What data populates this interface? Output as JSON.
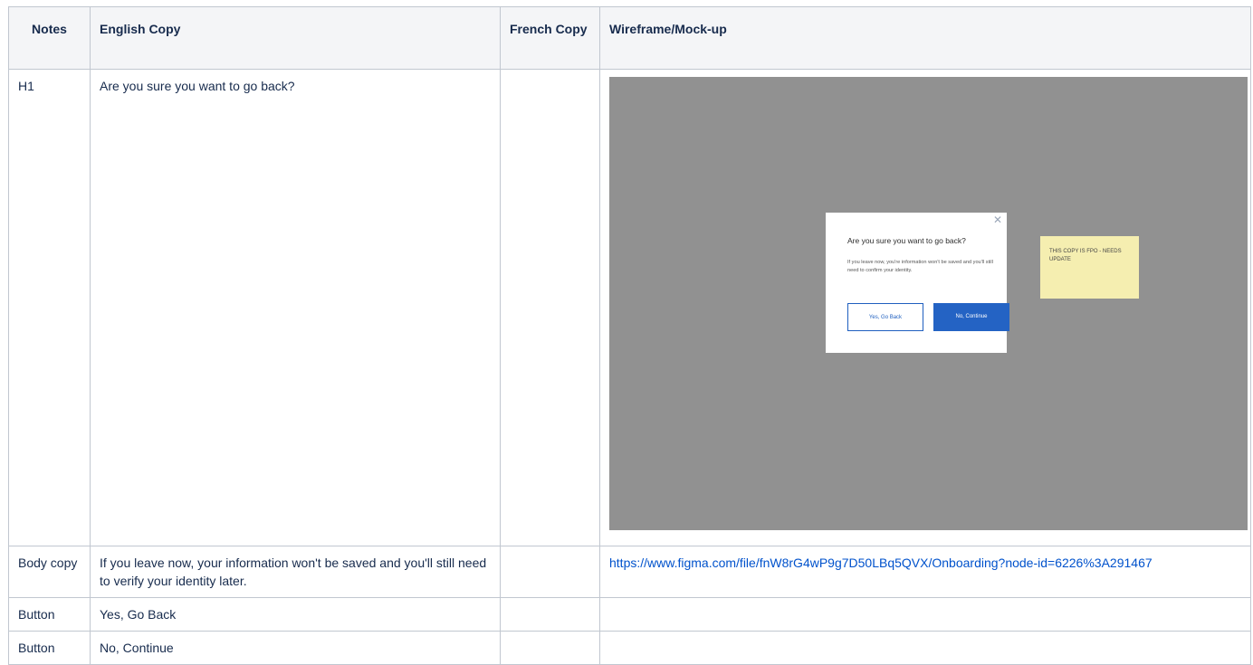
{
  "table": {
    "headers": {
      "notes": "Notes",
      "english": "English Copy",
      "french": "French Copy",
      "wireframe": "Wireframe/Mock-up"
    },
    "rows": [
      {
        "notes": "H1",
        "english": "Are you sure you want to go back?",
        "french": ""
      },
      {
        "notes": "Body copy",
        "english": "If you leave now, your information won't be saved and you'll still need to verify your identity later.",
        "french": "",
        "link": "https://www.figma.com/file/fnW8rG4wP9g7D50LBq5QVX/Onboarding?node-id=6226%3A291467"
      },
      {
        "notes": "Button",
        "english": "Yes, Go Back",
        "french": ""
      },
      {
        "notes": "Button",
        "english": "No, Continue",
        "french": ""
      }
    ]
  },
  "mockup": {
    "close_icon": "close-icon",
    "title": "Are you sure you want to go back?",
    "body": "If you leave now, you're information won't be saved and you'll still need to confirm your identity.",
    "yes_button": "Yes, Go Back",
    "no_button": "No, Continue",
    "sticky_note": "THIS COPY IS FPO - NEEDS UPDATE",
    "colors": {
      "backdrop": "#919191",
      "primary": "#2463c4",
      "sticky": "#f5eeb0"
    }
  }
}
